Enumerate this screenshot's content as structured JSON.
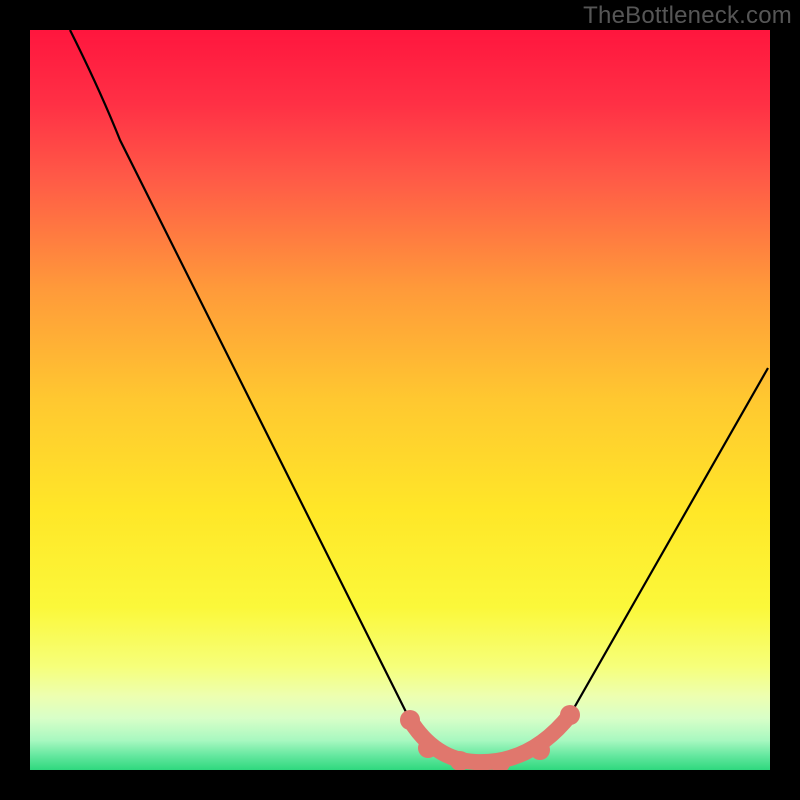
{
  "watermark": "TheBottleneck.com",
  "colors": {
    "background_frame": "#000000",
    "curve": "#000000",
    "highlight": "#e0776d",
    "gradient_top": "#ff163e",
    "gradient_mid": "#ffe728",
    "gradient_bottom": "#2fd87e"
  },
  "chart_data": {
    "type": "line",
    "title": "",
    "xlabel": "",
    "ylabel": "",
    "x_range_normalized": [
      0,
      100
    ],
    "y_range_normalized": [
      0,
      100
    ],
    "description": "V-shaped bottleneck curve over a vertical red-to-green heat gradient; minimum (optimal balance) highlighted in salmon near x≈60. No axis ticks or numeric labels are rendered.",
    "series": [
      {
        "name": "bottleneck-curve",
        "color": "#000000",
        "x": [
          5,
          12,
          20,
          30,
          40,
          51,
          55,
          60,
          64,
          68,
          73,
          85,
          100
        ],
        "y": [
          100,
          85,
          70,
          52,
          34,
          7,
          2,
          1,
          1,
          3,
          8,
          30,
          54
        ]
      }
    ],
    "highlight": {
      "name": "optimal-region",
      "color": "#e0776d",
      "x": [
        51,
        54,
        58,
        64,
        69,
        73
      ],
      "y": [
        7,
        3,
        1,
        1,
        3,
        8
      ]
    },
    "background_gradient_axis": "y",
    "background_gradient_meaning": "red = high bottleneck, green = low bottleneck"
  }
}
